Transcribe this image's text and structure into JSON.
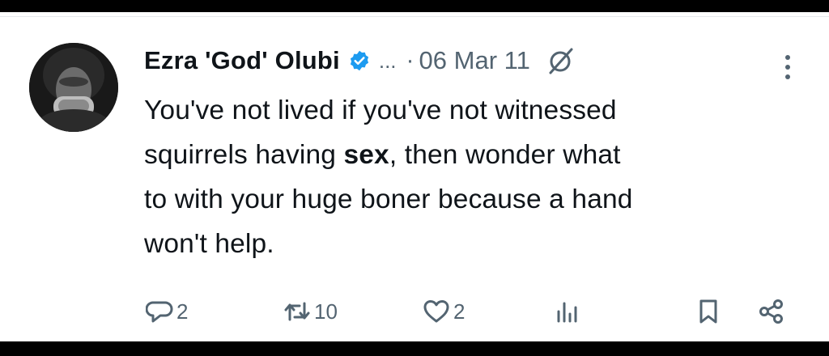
{
  "tweet": {
    "author_name": "Ezra 'God' Olubi",
    "ellipsis": "...",
    "separator": "·",
    "date": "06 Mar 11",
    "text_line1": "You've not lived if you've not witnessed",
    "text_line2_a": "squirrels having ",
    "text_line2_bold": "sex",
    "text_line2_b": ", then wonder what",
    "text_line3": "to with your huge boner because a hand",
    "text_line4": "won't help."
  },
  "actions": {
    "reply_count": "2",
    "retweet_count": "10",
    "like_count": "2"
  },
  "icons": [
    "verified-badge-icon",
    "grok-icon",
    "more-icon",
    "reply-icon",
    "retweet-icon",
    "like-icon",
    "views-icon",
    "bookmark-icon",
    "share-icon"
  ],
  "colors": {
    "verified": "#1d9bf0",
    "text": "#0f1419",
    "muted": "#536471"
  }
}
